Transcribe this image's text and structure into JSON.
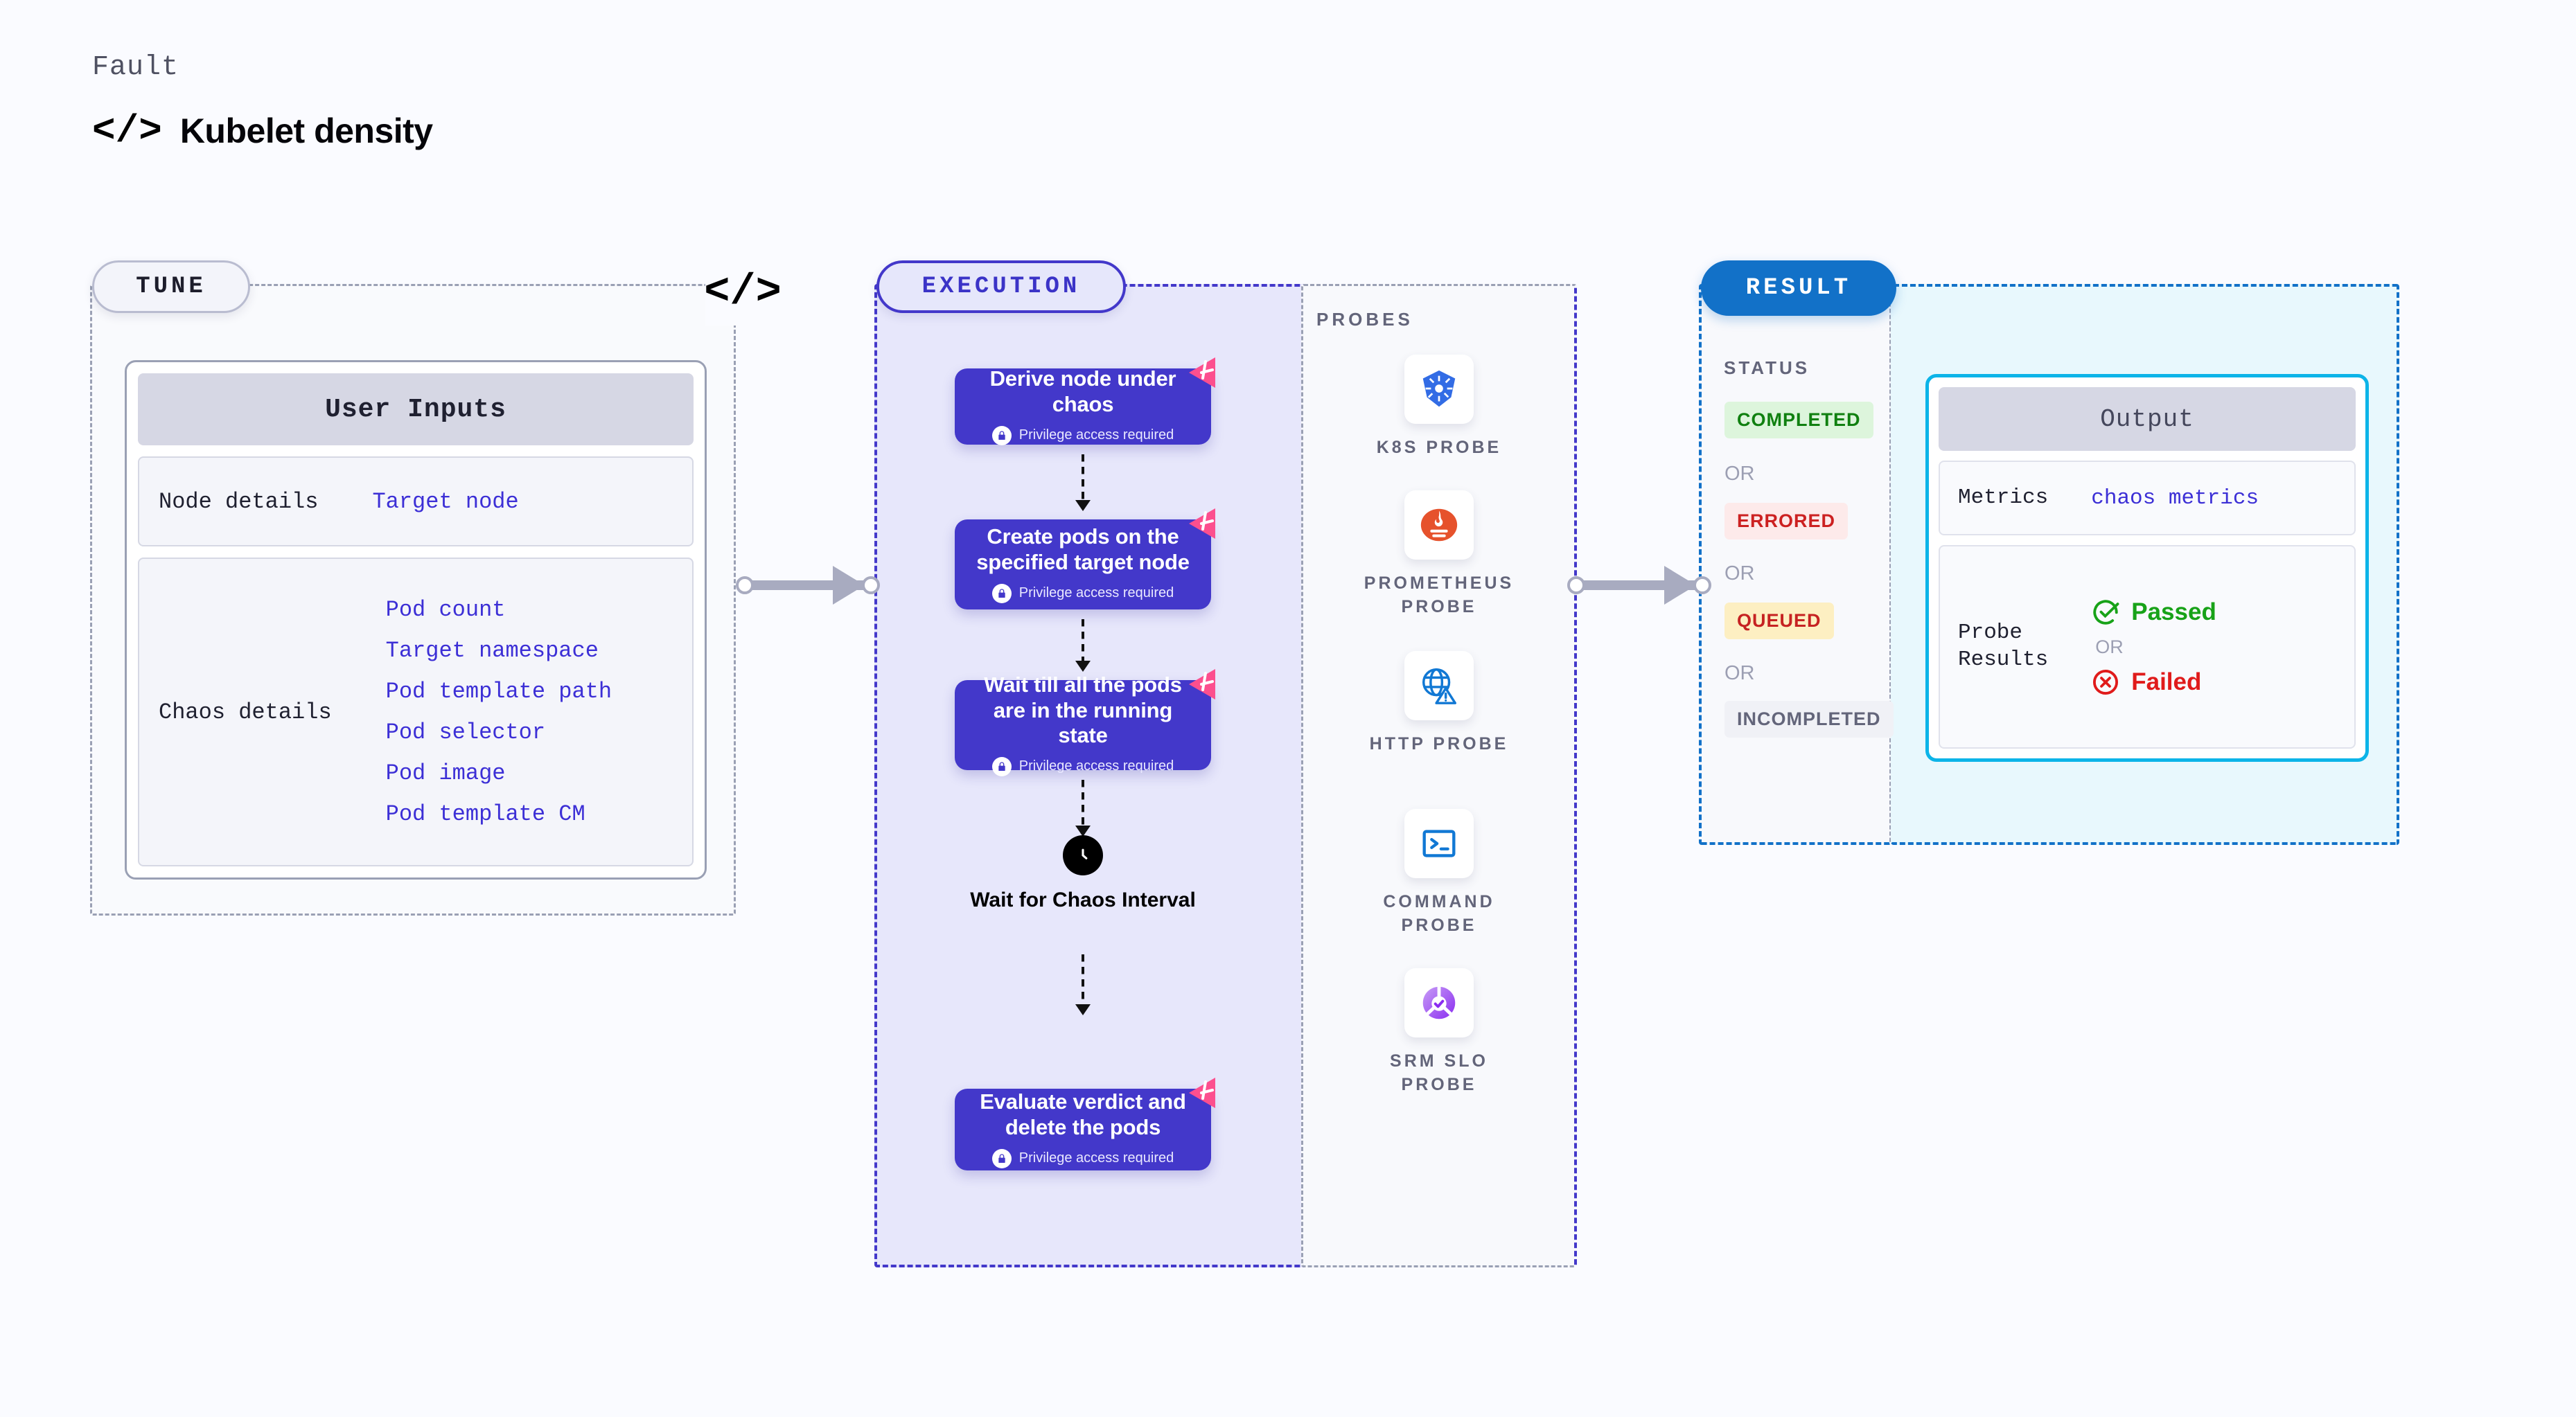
{
  "header": {
    "eyebrow": "Fault",
    "code_icon": "</>",
    "title": "Kubelet density"
  },
  "tune": {
    "pill_label": "TUNE",
    "code_marker": "</>",
    "card_title": "User Inputs",
    "rows": [
      {
        "label": "Node details",
        "values": [
          "Target node"
        ]
      },
      {
        "label": "Chaos details",
        "values": [
          "Pod count",
          "Target namespace",
          "Pod template path",
          "Pod selector",
          "Pod image",
          "Pod template CM"
        ]
      }
    ]
  },
  "execution": {
    "pill_label": "EXECUTION",
    "privilege_note": "Privilege access required",
    "steps": [
      {
        "title": "Derive node under chaos"
      },
      {
        "title": "Create pods on the specified target node"
      },
      {
        "title": "Wait till all the pods are in the running state"
      }
    ],
    "wait_node": {
      "label": "Wait for Chaos Interval",
      "icon": "clock-icon"
    },
    "final_step": {
      "title": "Evaluate verdict and delete the pods"
    }
  },
  "probes": {
    "title": "PROBES",
    "items": [
      {
        "label": "K8S PROBE",
        "icon": "kubernetes-icon"
      },
      {
        "label": "PROMETHEUS PROBE",
        "icon": "prometheus-icon"
      },
      {
        "label": "HTTP PROBE",
        "icon": "globe-warning-icon"
      },
      {
        "label": "COMMAND PROBE",
        "icon": "terminal-icon"
      },
      {
        "label": "SRM SLO PROBE",
        "icon": "srm-slo-icon"
      }
    ]
  },
  "result": {
    "pill_label": "RESULT",
    "status_title": "STATUS",
    "or_label": "OR",
    "statuses": [
      {
        "label": "COMPLETED",
        "bg": "#ddf5dc",
        "fg": "#108010"
      },
      {
        "label": "ERRORED",
        "bg": "#fdeaea",
        "fg": "#cc2121"
      },
      {
        "label": "QUEUED",
        "bg": "#fdefc2",
        "fg": "#c62222"
      },
      {
        "label": "INCOMPLETED",
        "bg": "#f0f1f6",
        "fg": "#63657a"
      }
    ],
    "output": {
      "title": "Output",
      "metrics_label": "Metrics",
      "metrics_value": "chaos metrics",
      "probe_results_label": "Probe\nResults",
      "passed_label": "Passed",
      "failed_label": "Failed",
      "or_label": "OR",
      "passed_color": "#18a218",
      "failed_color": "#e01b1b"
    }
  },
  "colors": {
    "page_bg": "#fafbff",
    "execution_accent": "#4338ca",
    "result_accent": "#1271c8",
    "output_border": "#0cb4e8",
    "link_text": "#3c2fd6",
    "harness_pink": "#fc4f8e"
  }
}
